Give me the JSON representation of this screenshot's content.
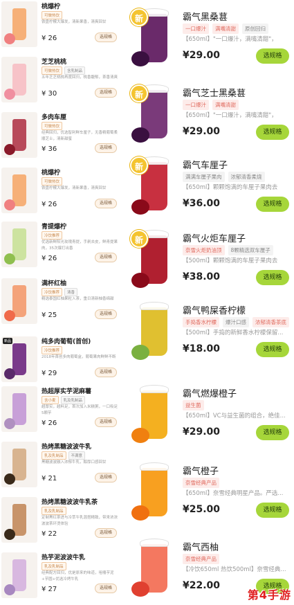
{
  "left_items": [
    {
      "name": "桃爆柠",
      "tags": [
        "可做热饮"
      ],
      "desc": "铁盘柠檬大爆发，清新果香，清爽回甘",
      "price": "¥ 26",
      "button": "选规格",
      "cup_color": "#f6b078",
      "fruit_color": "#f08080"
    },
    {
      "name": "芝芝桃桃",
      "tags": [
        "可做热饮",
        "含乳制品"
      ],
      "desc": "五年芝芝桃桃再度回归，桃香馥郁，茶香清爽",
      "price": "¥ 30",
      "button": "选规格",
      "cup_color": "#f7c3c8",
      "fruit_color": "#f08fa0"
    },
    {
      "name": "多肉车厘",
      "tags": [
        "可做热饮"
      ],
      "desc": "经典回归，优选智利鲜车厘子，无香精葡萄柔顺芝士，清新甜蜜",
      "price": "¥ 36",
      "button": "选规格",
      "cup_color": "#b84a5a",
      "fruit_color": "#8a1a2a"
    },
    {
      "name": "桃爆柠",
      "tags": [
        "可做热饮"
      ],
      "desc": "铁盘柠檬大爆发，清新果香，清爽回甘",
      "price": "¥ 26",
      "button": "选规格",
      "cup_color": "#f6b078",
      "fruit_color": "#f08080"
    },
    {
      "name": "青提爆柠",
      "tags": [
        "冷饮推荐"
      ],
      "desc": "优选新鲜阳光玫瑰青提，手剥去皮，鲜青提果肉，35次爆打出香",
      "price": "¥ 26",
      "button": "选规格",
      "cup_color": "#cde3a0",
      "fruit_color": "#8fbf4f"
    },
    {
      "name": "满杯红柚",
      "tags": [
        "冷饮推荐",
        "清香"
      ],
      "desc": "精选泰国红柚果粒入茶，重日清新柚香绵甜",
      "price": "¥ 25",
      "button": "选规格",
      "cup_color": "#f4a37a",
      "fruit_color": "#f06a4a"
    },
    {
      "name": "纯多肉葡萄(首创)",
      "tags": [
        "冷饮推荐"
      ],
      "desc": "2018年首创多肉葡萄盒，葡萄果肉鲜鲜不断",
      "price": "¥ 29",
      "button": "选规格",
      "cup_color": "#7a3a8a",
      "fruit_color": "#5a2a6a",
      "badge": "新品"
    },
    {
      "name": "热超厚实芋泥麻薯",
      "tags": [
        "含小麦",
        "乳及乳制品"
      ],
      "desc": "超厚实，超料足，首次加入米糕粥，一口吸足5颗芋",
      "price": "¥ 26",
      "button": "选规格",
      "cup_color": "#c8a0d8",
      "fruit_color": "#b090c0"
    },
    {
      "name": "热烤黑糖波波牛乳",
      "tags": [
        "乳及乳制品",
        "不满意"
      ],
      "desc": "黑糖波波融入浓郁牛乳，醇厚口感回甘",
      "price": "¥ 21",
      "button": "选规格",
      "cup_color": "#d8b490",
      "fruit_color": "#3a2a1a"
    },
    {
      "name": "热烤黑糖波波牛乳茶",
      "tags": [
        "乳及乳制品"
      ],
      "desc": "定制黑红茶进与冷萃牛乳混搭精致，带来浓浓波波茶环烫体验",
      "price": "¥ 22",
      "button": "选规格",
      "cup_color": "#c8946a",
      "fruit_color": "#3a2a1a"
    },
    {
      "name": "热芋泥波波牛乳",
      "tags": [
        "乳及乳制品"
      ],
      "desc": "经典配方回归，优是原来的味道，咀嚼芋泥+芋圆+优选冷烤牛乳",
      "price": "¥ 27",
      "button": "选规格",
      "cup_color": "#d8b8e0",
      "fruit_color": "#a888c0"
    }
  ],
  "right_items": [
    {
      "name": "霸气黑桑葚",
      "tags": [
        {
          "t": "一口爆汁",
          "s": "pink"
        },
        {
          "t": "满嘴清甜",
          "s": "pink"
        },
        {
          "t": "原创回归",
          "s": "grey"
        }
      ],
      "desc": "【650ml】\"一口爆汁，满嘴清甜\"，",
      "price": "¥29.00",
      "button": "选规格",
      "cup_color": "#6a2a6a",
      "fruit_color": "#3a1040",
      "new": true
    },
    {
      "name": "霸气芝士黑桑葚",
      "tags": [
        {
          "t": "一口爆汁",
          "s": "pink"
        },
        {
          "t": "满嘴清甜",
          "s": "pink"
        }
      ],
      "desc": "【650ml】\"一口爆汁，满嘴清甜\"，",
      "price": "¥29.00",
      "button": "选规格",
      "cup_color": "#7a3a7a",
      "fruit_color": "#3a1040",
      "new": true
    },
    {
      "name": "霸气车厘子",
      "tags": [
        {
          "t": "满满车厘子果肉",
          "s": "grey"
        },
        {
          "t": "浓郁清香柔烧",
          "s": "grey"
        }
      ],
      "desc": "【650ml】颗颗饱满的车厘子果肉去",
      "price": "¥36.00",
      "button": "选规格",
      "cup_color": "#c83040",
      "fruit_color": "#8a0a1a",
      "new": true
    },
    {
      "name": "霸气火炬车厘子",
      "tags": [
        {
          "t": "奈雪火炬奶油顶",
          "s": "pink"
        },
        {
          "t": "8颗精选双车厘子",
          "s": "grey"
        }
      ],
      "desc": "【500ml】颗颗饱满的车厘子果肉去",
      "price": "¥38.00",
      "button": "选规格",
      "cup_color": "#b02030",
      "fruit_color": "#8a0a1a",
      "new": true
    },
    {
      "name": "霸气鸭屎香柠檬",
      "tags": [
        {
          "t": "手捣香水柠檬",
          "s": "pink"
        },
        {
          "t": "爆汁口感",
          "s": "grey"
        },
        {
          "t": "浓郁清香茶底",
          "s": "pink"
        }
      ],
      "desc": "【500ml】手捣的新鲜香水柠檬保留...",
      "price": "¥18.00",
      "button": "选规格",
      "cup_color": "#e0c030",
      "fruit_color": "#7ab040",
      "new": false
    },
    {
      "name": "霸气燃爆橙子",
      "tags": [
        {
          "t": "益生菌",
          "s": "pink"
        }
      ],
      "desc": "【650ml】VC与益生菌的组合，绝佳...",
      "price": "¥29.00",
      "button": "选规格",
      "cup_color": "#f4b020",
      "fruit_color": "#f08010",
      "new": false
    },
    {
      "name": "霸气橙子",
      "tags": [
        {
          "t": "奈雪经典产品",
          "s": "pink"
        }
      ],
      "desc": "【650ml】奈雪经典明星产品。严选...",
      "price": "¥25.00",
      "button": "选规格",
      "cup_color": "#f8a020",
      "fruit_color": "#f07010",
      "new": false
    },
    {
      "name": "霸气西柚",
      "tags": [
        {
          "t": "奈雪经典产品",
          "s": "pink"
        }
      ],
      "desc": "【冷饮650ml 热饮500ml】奈雪经典...",
      "price": "¥22.00",
      "button": "选规格",
      "cup_color": "#f47860",
      "fruit_color": "#e04030",
      "new": false
    }
  ],
  "new_badge_label": "新",
  "watermark": "第4手游"
}
